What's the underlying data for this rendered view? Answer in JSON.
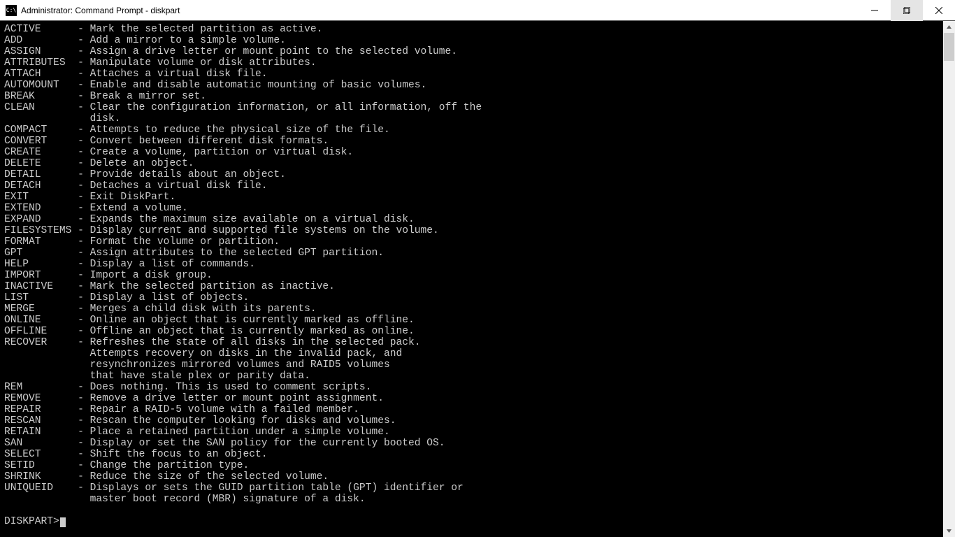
{
  "window": {
    "title": "Administrator: Command Prompt - diskpart"
  },
  "prompt": "DISKPART>",
  "sep": "- ",
  "commands": [
    {
      "name": "ACTIVE",
      "desc": "Mark the selected partition as active."
    },
    {
      "name": "ADD",
      "desc": "Add a mirror to a simple volume."
    },
    {
      "name": "ASSIGN",
      "desc": "Assign a drive letter or mount point to the selected volume."
    },
    {
      "name": "ATTRIBUTES",
      "desc": "Manipulate volume or disk attributes."
    },
    {
      "name": "ATTACH",
      "desc": "Attaches a virtual disk file."
    },
    {
      "name": "AUTOMOUNT",
      "desc": "Enable and disable automatic mounting of basic volumes."
    },
    {
      "name": "BREAK",
      "desc": "Break a mirror set."
    },
    {
      "name": "CLEAN",
      "desc": "Clear the configuration information, or all information, off the",
      "cont": [
        "disk."
      ]
    },
    {
      "name": "COMPACT",
      "desc": "Attempts to reduce the physical size of the file."
    },
    {
      "name": "CONVERT",
      "desc": "Convert between different disk formats."
    },
    {
      "name": "CREATE",
      "desc": "Create a volume, partition or virtual disk."
    },
    {
      "name": "DELETE",
      "desc": "Delete an object."
    },
    {
      "name": "DETAIL",
      "desc": "Provide details about an object."
    },
    {
      "name": "DETACH",
      "desc": "Detaches a virtual disk file."
    },
    {
      "name": "EXIT",
      "desc": "Exit DiskPart."
    },
    {
      "name": "EXTEND",
      "desc": "Extend a volume."
    },
    {
      "name": "EXPAND",
      "desc": "Expands the maximum size available on a virtual disk."
    },
    {
      "name": "FILESYSTEMS",
      "desc": "Display current and supported file systems on the volume."
    },
    {
      "name": "FORMAT",
      "desc": "Format the volume or partition."
    },
    {
      "name": "GPT",
      "desc": "Assign attributes to the selected GPT partition."
    },
    {
      "name": "HELP",
      "desc": "Display a list of commands."
    },
    {
      "name": "IMPORT",
      "desc": "Import a disk group."
    },
    {
      "name": "INACTIVE",
      "desc": "Mark the selected partition as inactive."
    },
    {
      "name": "LIST",
      "desc": "Display a list of objects."
    },
    {
      "name": "MERGE",
      "desc": "Merges a child disk with its parents."
    },
    {
      "name": "ONLINE",
      "desc": "Online an object that is currently marked as offline."
    },
    {
      "name": "OFFLINE",
      "desc": "Offline an object that is currently marked as online."
    },
    {
      "name": "RECOVER",
      "desc": "Refreshes the state of all disks in the selected pack.",
      "cont": [
        "Attempts recovery on disks in the invalid pack, and",
        "resynchronizes mirrored volumes and RAID5 volumes",
        "that have stale plex or parity data."
      ]
    },
    {
      "name": "REM",
      "desc": "Does nothing. This is used to comment scripts."
    },
    {
      "name": "REMOVE",
      "desc": "Remove a drive letter or mount point assignment."
    },
    {
      "name": "REPAIR",
      "desc": "Repair a RAID-5 volume with a failed member."
    },
    {
      "name": "RESCAN",
      "desc": "Rescan the computer looking for disks and volumes."
    },
    {
      "name": "RETAIN",
      "desc": "Place a retained partition under a simple volume."
    },
    {
      "name": "SAN",
      "desc": "Display or set the SAN policy for the currently booted OS."
    },
    {
      "name": "SELECT",
      "desc": "Shift the focus to an object."
    },
    {
      "name": "SETID",
      "desc": "Change the partition type."
    },
    {
      "name": "SHRINK",
      "desc": "Reduce the size of the selected volume."
    },
    {
      "name": "UNIQUEID",
      "desc": "Displays or sets the GUID partition table (GPT) identifier or",
      "cont": [
        "master boot record (MBR) signature of a disk."
      ]
    }
  ]
}
